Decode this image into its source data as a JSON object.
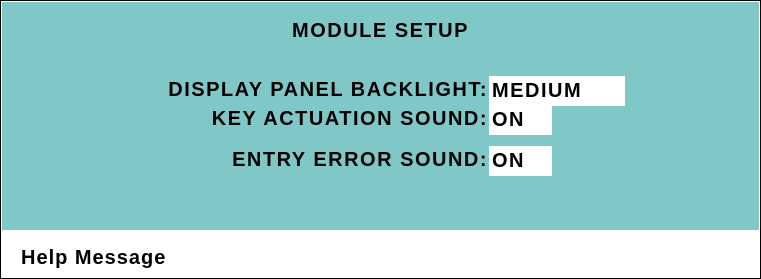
{
  "title": "MODULE SETUP",
  "settings": [
    {
      "label": "DISPLAY PANEL BACKLIGHT:",
      "value": "MEDIUM"
    },
    {
      "label": "KEY ACTUATION SOUND:",
      "value": "ON"
    },
    {
      "label": "ENTRY ERROR SOUND:",
      "value": "ON"
    }
  ],
  "help": {
    "text": "Help Message"
  },
  "colors": {
    "panel_background": "#80c8c8",
    "value_field_background": "#ffffff",
    "text": "#000000"
  }
}
